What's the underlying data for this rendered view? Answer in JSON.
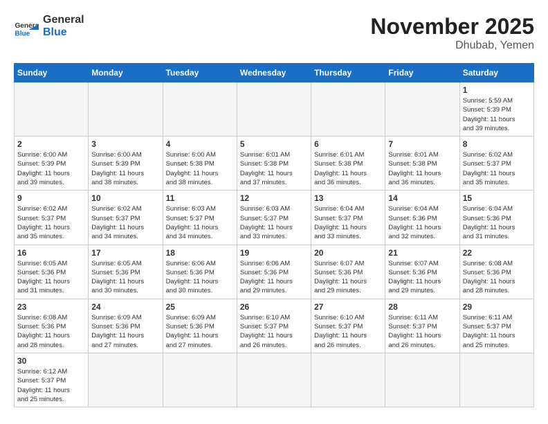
{
  "header": {
    "logo_general": "General",
    "logo_blue": "Blue",
    "month_title": "November 2025",
    "location": "Dhubab, Yemen"
  },
  "days_of_week": [
    "Sunday",
    "Monday",
    "Tuesday",
    "Wednesday",
    "Thursday",
    "Friday",
    "Saturday"
  ],
  "weeks": [
    [
      {
        "day": null,
        "info": ""
      },
      {
        "day": null,
        "info": ""
      },
      {
        "day": null,
        "info": ""
      },
      {
        "day": null,
        "info": ""
      },
      {
        "day": null,
        "info": ""
      },
      {
        "day": null,
        "info": ""
      },
      {
        "day": "1",
        "info": "Sunrise: 5:59 AM\nSunset: 5:39 PM\nDaylight: 11 hours\nand 39 minutes."
      }
    ],
    [
      {
        "day": "2",
        "info": "Sunrise: 6:00 AM\nSunset: 5:39 PM\nDaylight: 11 hours\nand 39 minutes."
      },
      {
        "day": "3",
        "info": "Sunrise: 6:00 AM\nSunset: 5:39 PM\nDaylight: 11 hours\nand 38 minutes."
      },
      {
        "day": "4",
        "info": "Sunrise: 6:00 AM\nSunset: 5:38 PM\nDaylight: 11 hours\nand 38 minutes."
      },
      {
        "day": "5",
        "info": "Sunrise: 6:01 AM\nSunset: 5:38 PM\nDaylight: 11 hours\nand 37 minutes."
      },
      {
        "day": "6",
        "info": "Sunrise: 6:01 AM\nSunset: 5:38 PM\nDaylight: 11 hours\nand 36 minutes."
      },
      {
        "day": "7",
        "info": "Sunrise: 6:01 AM\nSunset: 5:38 PM\nDaylight: 11 hours\nand 36 minutes."
      },
      {
        "day": "8",
        "info": "Sunrise: 6:02 AM\nSunset: 5:37 PM\nDaylight: 11 hours\nand 35 minutes."
      }
    ],
    [
      {
        "day": "9",
        "info": "Sunrise: 6:02 AM\nSunset: 5:37 PM\nDaylight: 11 hours\nand 35 minutes."
      },
      {
        "day": "10",
        "info": "Sunrise: 6:02 AM\nSunset: 5:37 PM\nDaylight: 11 hours\nand 34 minutes."
      },
      {
        "day": "11",
        "info": "Sunrise: 6:03 AM\nSunset: 5:37 PM\nDaylight: 11 hours\nand 34 minutes."
      },
      {
        "day": "12",
        "info": "Sunrise: 6:03 AM\nSunset: 5:37 PM\nDaylight: 11 hours\nand 33 minutes."
      },
      {
        "day": "13",
        "info": "Sunrise: 6:04 AM\nSunset: 5:37 PM\nDaylight: 11 hours\nand 33 minutes."
      },
      {
        "day": "14",
        "info": "Sunrise: 6:04 AM\nSunset: 5:36 PM\nDaylight: 11 hours\nand 32 minutes."
      },
      {
        "day": "15",
        "info": "Sunrise: 6:04 AM\nSunset: 5:36 PM\nDaylight: 11 hours\nand 31 minutes."
      }
    ],
    [
      {
        "day": "16",
        "info": "Sunrise: 6:05 AM\nSunset: 5:36 PM\nDaylight: 11 hours\nand 31 minutes."
      },
      {
        "day": "17",
        "info": "Sunrise: 6:05 AM\nSunset: 5:36 PM\nDaylight: 11 hours\nand 30 minutes."
      },
      {
        "day": "18",
        "info": "Sunrise: 6:06 AM\nSunset: 5:36 PM\nDaylight: 11 hours\nand 30 minutes."
      },
      {
        "day": "19",
        "info": "Sunrise: 6:06 AM\nSunset: 5:36 PM\nDaylight: 11 hours\nand 29 minutes."
      },
      {
        "day": "20",
        "info": "Sunrise: 6:07 AM\nSunset: 5:36 PM\nDaylight: 11 hours\nand 29 minutes."
      },
      {
        "day": "21",
        "info": "Sunrise: 6:07 AM\nSunset: 5:36 PM\nDaylight: 11 hours\nand 29 minutes."
      },
      {
        "day": "22",
        "info": "Sunrise: 6:08 AM\nSunset: 5:36 PM\nDaylight: 11 hours\nand 28 minutes."
      }
    ],
    [
      {
        "day": "23",
        "info": "Sunrise: 6:08 AM\nSunset: 5:36 PM\nDaylight: 11 hours\nand 28 minutes."
      },
      {
        "day": "24",
        "info": "Sunrise: 6:09 AM\nSunset: 5:36 PM\nDaylight: 11 hours\nand 27 minutes."
      },
      {
        "day": "25",
        "info": "Sunrise: 6:09 AM\nSunset: 5:36 PM\nDaylight: 11 hours\nand 27 minutes."
      },
      {
        "day": "26",
        "info": "Sunrise: 6:10 AM\nSunset: 5:37 PM\nDaylight: 11 hours\nand 26 minutes."
      },
      {
        "day": "27",
        "info": "Sunrise: 6:10 AM\nSunset: 5:37 PM\nDaylight: 11 hours\nand 26 minutes."
      },
      {
        "day": "28",
        "info": "Sunrise: 6:11 AM\nSunset: 5:37 PM\nDaylight: 11 hours\nand 26 minutes."
      },
      {
        "day": "29",
        "info": "Sunrise: 6:11 AM\nSunset: 5:37 PM\nDaylight: 11 hours\nand 25 minutes."
      }
    ],
    [
      {
        "day": "30",
        "info": "Sunrise: 6:12 AM\nSunset: 5:37 PM\nDaylight: 11 hours\nand 25 minutes."
      },
      {
        "day": null,
        "info": ""
      },
      {
        "day": null,
        "info": ""
      },
      {
        "day": null,
        "info": ""
      },
      {
        "day": null,
        "info": ""
      },
      {
        "day": null,
        "info": ""
      },
      {
        "day": null,
        "info": ""
      }
    ]
  ]
}
